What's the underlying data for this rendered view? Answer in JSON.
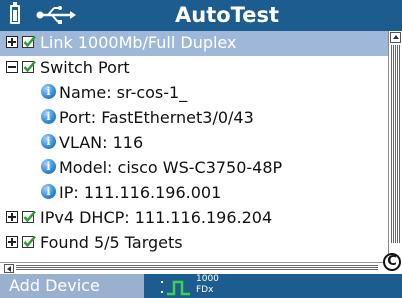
{
  "header": {
    "title": "AutoTest",
    "battery_icon": "battery-icon",
    "usb_icon": "usb-icon"
  },
  "tree": {
    "rows": [
      {
        "text": "Link 1000Mb/Full Duplex",
        "expander": "plus",
        "checked": true,
        "selected": true
      },
      {
        "text": "Switch Port",
        "expander": "minus",
        "checked": true
      },
      {
        "text": "Name: sr-cos-1_",
        "info": true
      },
      {
        "text": "Port: FastEthernet3/0/43",
        "info": true
      },
      {
        "text": "VLAN: 116",
        "info": true
      },
      {
        "text": "Model: cisco WS-C3750-48P",
        "info": true
      },
      {
        "text": "IP: 111.116.196.001",
        "info": true
      },
      {
        "text": "IPv4 DHCP: 111.116.196.204",
        "expander": "plus",
        "checked": true
      },
      {
        "text": "Found 5/5 Targets",
        "expander": "plus",
        "checked": true
      }
    ]
  },
  "corner_button": "C",
  "footer": {
    "add_device_label": "Add Device",
    "link_speed": "1000",
    "link_duplex": "FDx"
  },
  "colors": {
    "title_bar": "#1c5c8f",
    "selection": "#9fb7d9",
    "check_green": "#2e9e2e"
  }
}
